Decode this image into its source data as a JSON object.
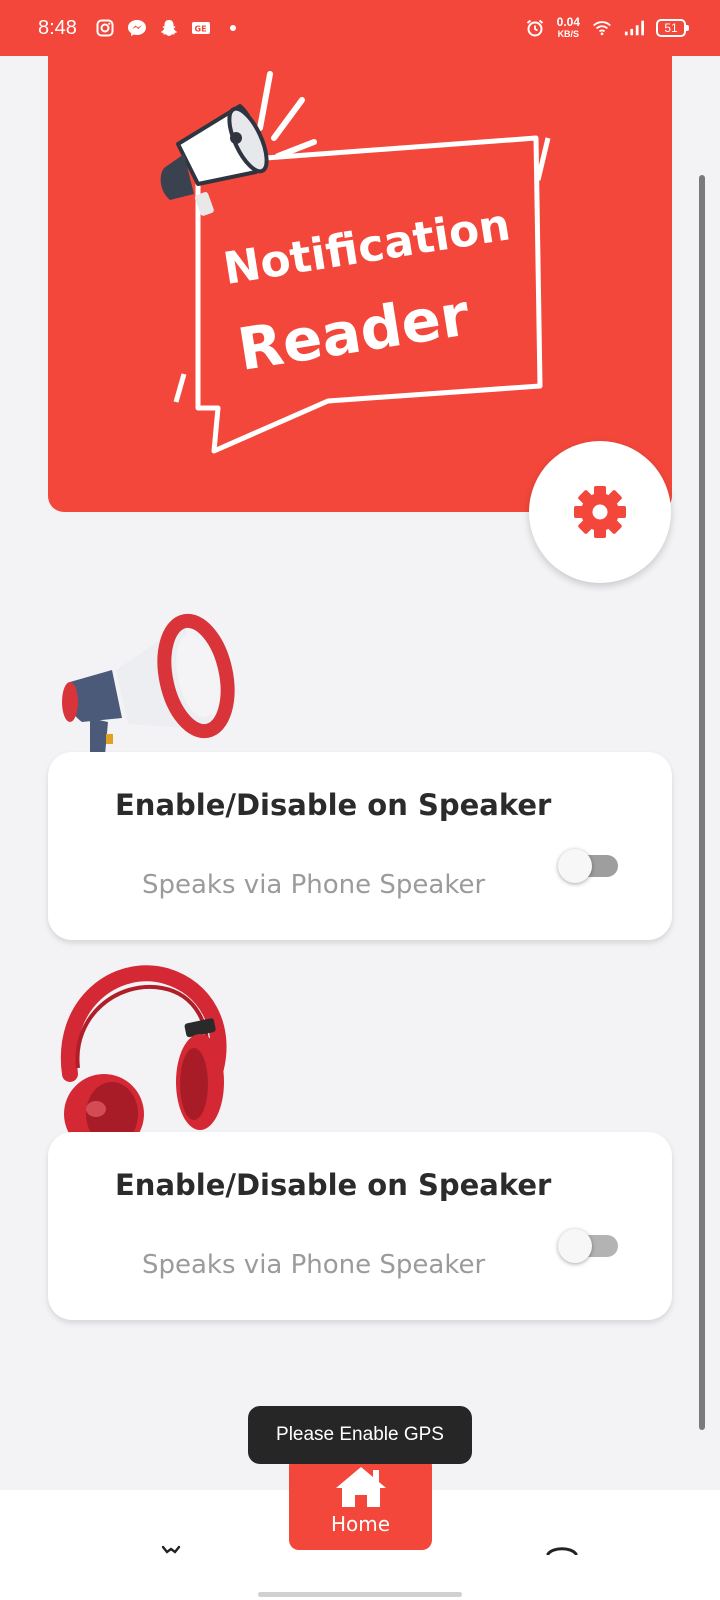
{
  "status_bar": {
    "time": "8:48",
    "network_speed_value": "0.04",
    "network_speed_unit": "KB/S",
    "battery": "51",
    "icons": [
      "instagram-icon",
      "messenger-icon",
      "snapchat-icon",
      "gallery-icon",
      "dot-icon",
      "alarm-icon",
      "wifi-icon",
      "signal-icon",
      "battery-icon"
    ]
  },
  "banner": {
    "line1": "Notification",
    "line2": "Reader",
    "icons": [
      "megaphone-icon"
    ]
  },
  "settings": {
    "icon": "gear-icon"
  },
  "cards": [
    {
      "title": "Enable/Disable on Speaker",
      "subtitle": "Speaks via Phone Speaker",
      "toggle_on": false,
      "illustration": "megaphone-icon"
    },
    {
      "title": "Enable/Disable on Speaker",
      "subtitle": "Speaks via Phone Speaker",
      "toggle_on": false,
      "illustration": "headphones-icon"
    }
  ],
  "toast": {
    "text": "Please Enable GPS"
  },
  "bottom_nav": {
    "active": {
      "label": "Home",
      "icon": "home-icon"
    }
  },
  "colors": {
    "accent": "#f4473b",
    "background": "#f3f3f6",
    "card": "#ffffff",
    "title_text": "#2b2b2b",
    "subtitle_text": "#9b9b9b"
  }
}
